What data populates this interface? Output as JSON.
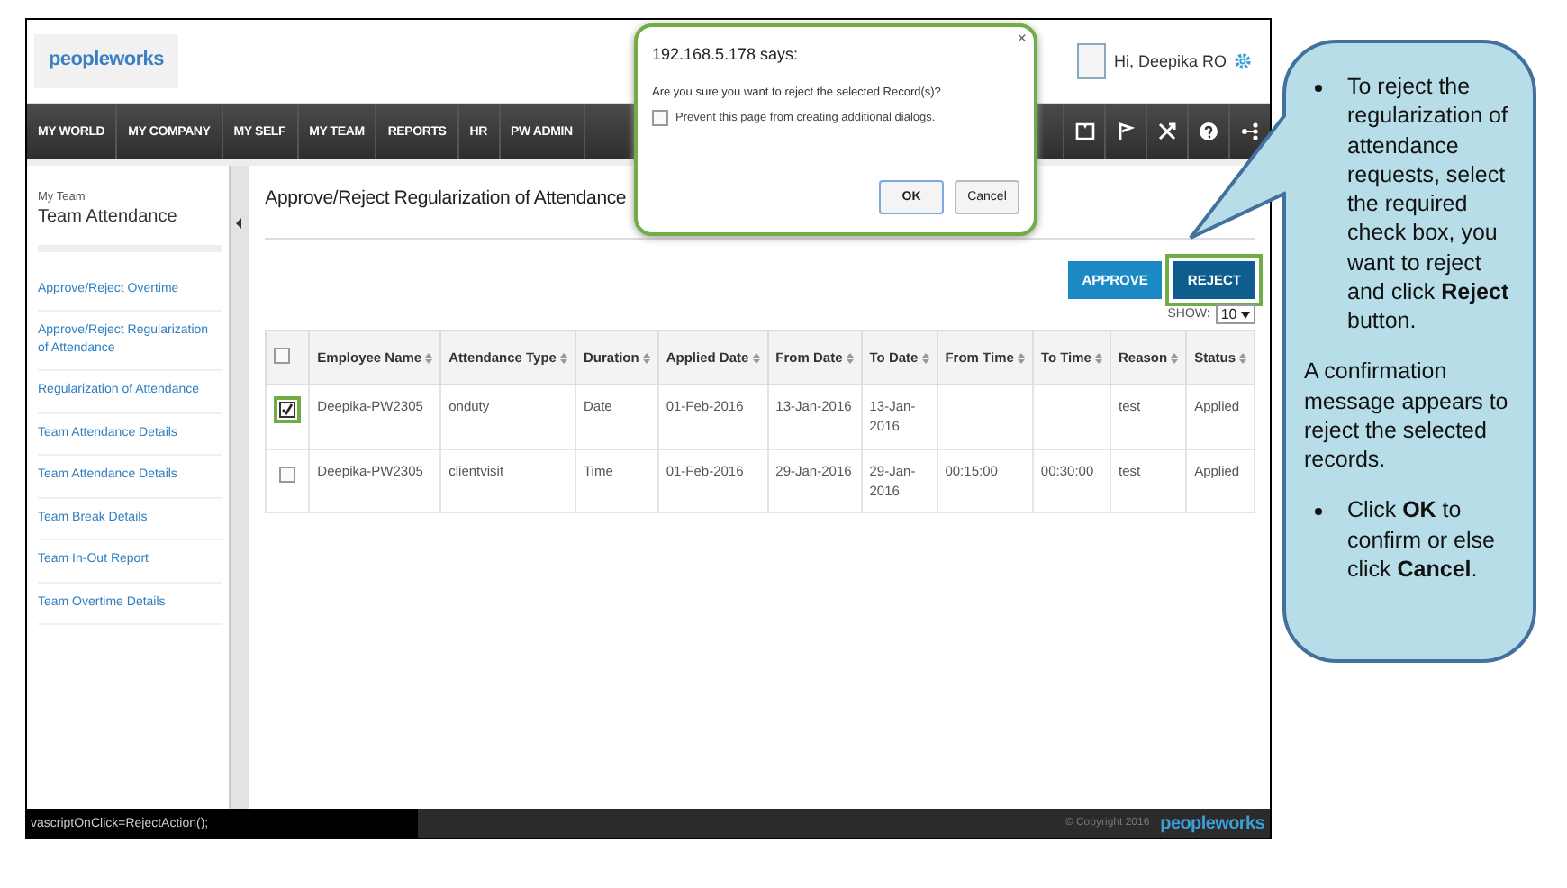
{
  "header": {
    "logo": "peopleworks",
    "greeting": "Hi, Deepika RO"
  },
  "nav": {
    "items": [
      "MY WORLD",
      "MY COMPANY",
      "MY SELF",
      "MY TEAM",
      "REPORTS",
      "HR",
      "PW ADMIN"
    ]
  },
  "dialog": {
    "title": "192.168.5.178 says:",
    "close": "×",
    "message": "Are you sure you want to reject the selected Record(s)?",
    "prevent": {
      "label": "Prevent this page from creating additional dialogs.",
      "checked": false
    },
    "buttons": [
      {
        "label": "OK",
        "selected": true
      },
      {
        "label": "Cancel",
        "selected": false
      }
    ]
  },
  "sidebar": {
    "section": "My Team",
    "title": "Team Attendance",
    "items": [
      "Approve/Reject Overtime",
      "Approve/Reject Regularization of Attendance",
      "Regularization of Attendance",
      "Team Attendance Details",
      "Team Attendance Details",
      "Team Break Details",
      "Team In-Out Report",
      "Team Overtime Details"
    ]
  },
  "page_title": "Approve/Reject Regularization of Attendance",
  "actions": [
    {
      "label": "APPROVE",
      "highlighted": false
    },
    {
      "label": "REJECT",
      "highlighted": true
    }
  ],
  "show": {
    "label": "SHOW:",
    "value": "10"
  },
  "table": {
    "select_all": {
      "checked": false
    },
    "columns": [
      "Employee Name",
      "Attendance Type",
      "Duration",
      "Applied Date",
      "From Date",
      "To Date",
      "From Time",
      "To Time",
      "Reason",
      "Status"
    ],
    "rows": [
      {
        "checked": true,
        "highlighted": true,
        "cells": [
          "Deepika-PW2305",
          "onduty",
          "Date",
          "01-Feb-2016",
          "13-Jan-2016",
          "13-Jan-2016",
          "",
          "",
          "test",
          "Applied"
        ]
      },
      {
        "checked": false,
        "highlighted": false,
        "cells": [
          "Deepika-PW2305",
          "clientvisit",
          "Time",
          "01-Feb-2016",
          "29-Jan-2016",
          "29-Jan-2016",
          "00:15:00",
          "00:30:00",
          "test",
          "Applied"
        ]
      }
    ]
  },
  "footer": {
    "status": "vascriptOnClick=RejectAction();",
    "copyright": "© Copyright 2016",
    "logo": "peopleworks"
  },
  "callout": {
    "items": [
      {
        "kind": "bullet",
        "text": "To reject the regularization of attendance requests, select the required check box, you want to reject and click **Reject** button."
      },
      {
        "kind": "paragraph",
        "text": "A confirmation message appears to reject the selected records."
      },
      {
        "kind": "bullet",
        "text": "Click **OK** to confirm or else click **Cancel**."
      }
    ]
  }
}
